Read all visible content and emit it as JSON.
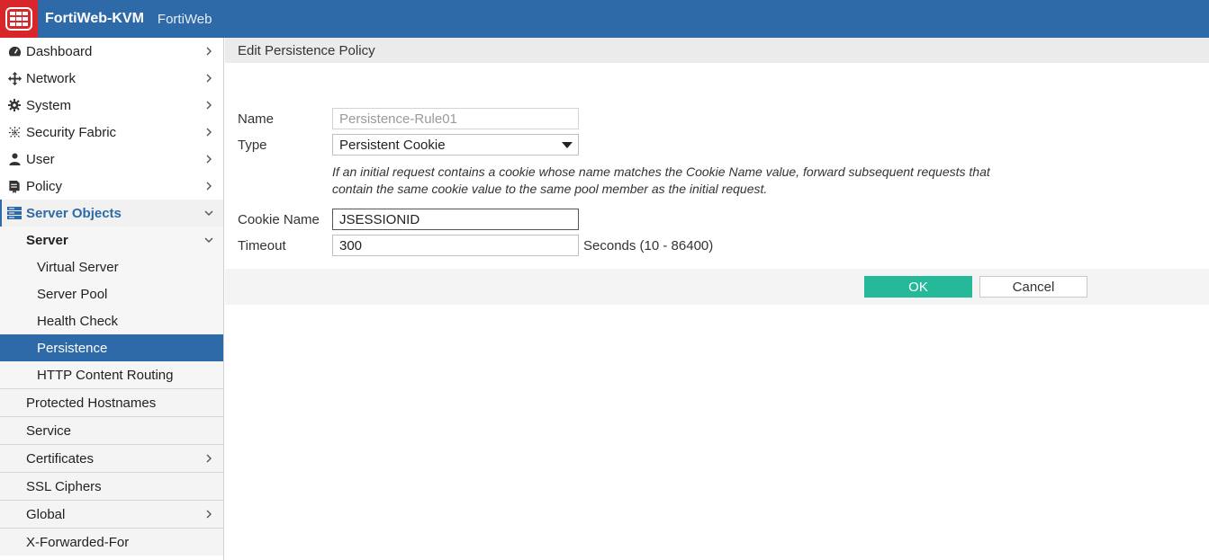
{
  "header": {
    "title": "FortiWeb-KVM",
    "subtitle": "FortiWeb",
    "brand_color": "#2f6aa8",
    "logo_color": "#d9262a"
  },
  "sidebar": {
    "items": [
      {
        "label": "Dashboard",
        "icon": "dashboard-icon"
      },
      {
        "label": "Network",
        "icon": "network-icon"
      },
      {
        "label": "System",
        "icon": "gear-icon"
      },
      {
        "label": "Security Fabric",
        "icon": "security-fabric-icon"
      },
      {
        "label": "User",
        "icon": "user-icon"
      },
      {
        "label": "Policy",
        "icon": "policy-icon"
      },
      {
        "label": "Server Objects",
        "icon": "server-objects-icon"
      }
    ],
    "server_group": "Server",
    "server_children": [
      "Virtual Server",
      "Server Pool",
      "Health Check",
      "Persistence",
      "HTTP Content Routing"
    ],
    "other_items": [
      "Protected Hostnames",
      "Service",
      "Certificates",
      "SSL Ciphers",
      "Global",
      "X-Forwarded-For"
    ]
  },
  "panel": {
    "title": "Edit Persistence Policy",
    "name_label": "Name",
    "name_value": "Persistence-Rule01",
    "type_label": "Type",
    "type_value": "Persistent Cookie",
    "help_line1": "If an initial request contains a cookie whose name matches the Cookie Name value, forward subsequent requests that",
    "help_line2": "contain the same cookie value to the same pool member as the initial request.",
    "cookie_label": "Cookie Name",
    "cookie_value": "JSESSIONID",
    "timeout_label": "Timeout",
    "timeout_value": "300",
    "timeout_unit": "Seconds (10 - 86400)",
    "ok_label": "OK",
    "cancel_label": "Cancel",
    "ok_color": "#25b99a"
  }
}
